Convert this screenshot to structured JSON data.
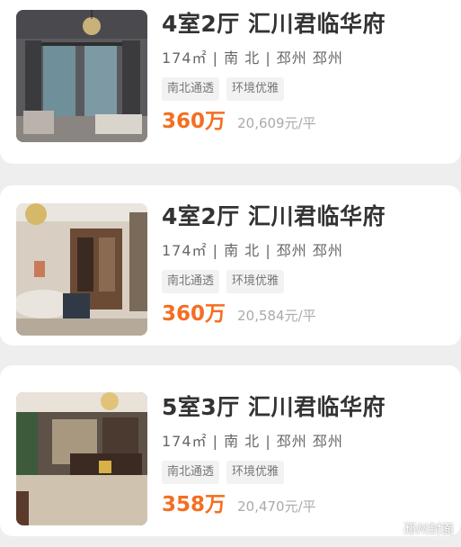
{
  "listings": [
    {
      "title": "4室2厅 汇川君临华府",
      "area": "174㎡",
      "orientation": "南 北",
      "district": "邳州 邳州",
      "tags": [
        "南北通透",
        "环境优雅"
      ],
      "price": "360万",
      "unit_price": "20,609元/平"
    },
    {
      "title": "4室2厅 汇川君临华府",
      "area": "174㎡",
      "orientation": "南 北",
      "district": "邳州 邳州",
      "tags": [
        "南北通透",
        "环境优雅"
      ],
      "price": "360万",
      "unit_price": "20,584元/平"
    },
    {
      "title": "5室3厅 汇川君临华府",
      "area": "174㎡",
      "orientation": "南 北",
      "district": "邳州 邳州",
      "tags": [
        "南北通透",
        "环境优雅"
      ],
      "price": "358万",
      "unit_price": "20,470元/平"
    }
  ],
  "watermark": {
    "text": "邳州封面",
    "icon": "wechat-icon"
  },
  "colors": {
    "price": "#f26f21",
    "title": "#333333",
    "tag_bg": "#f2f2f2"
  }
}
